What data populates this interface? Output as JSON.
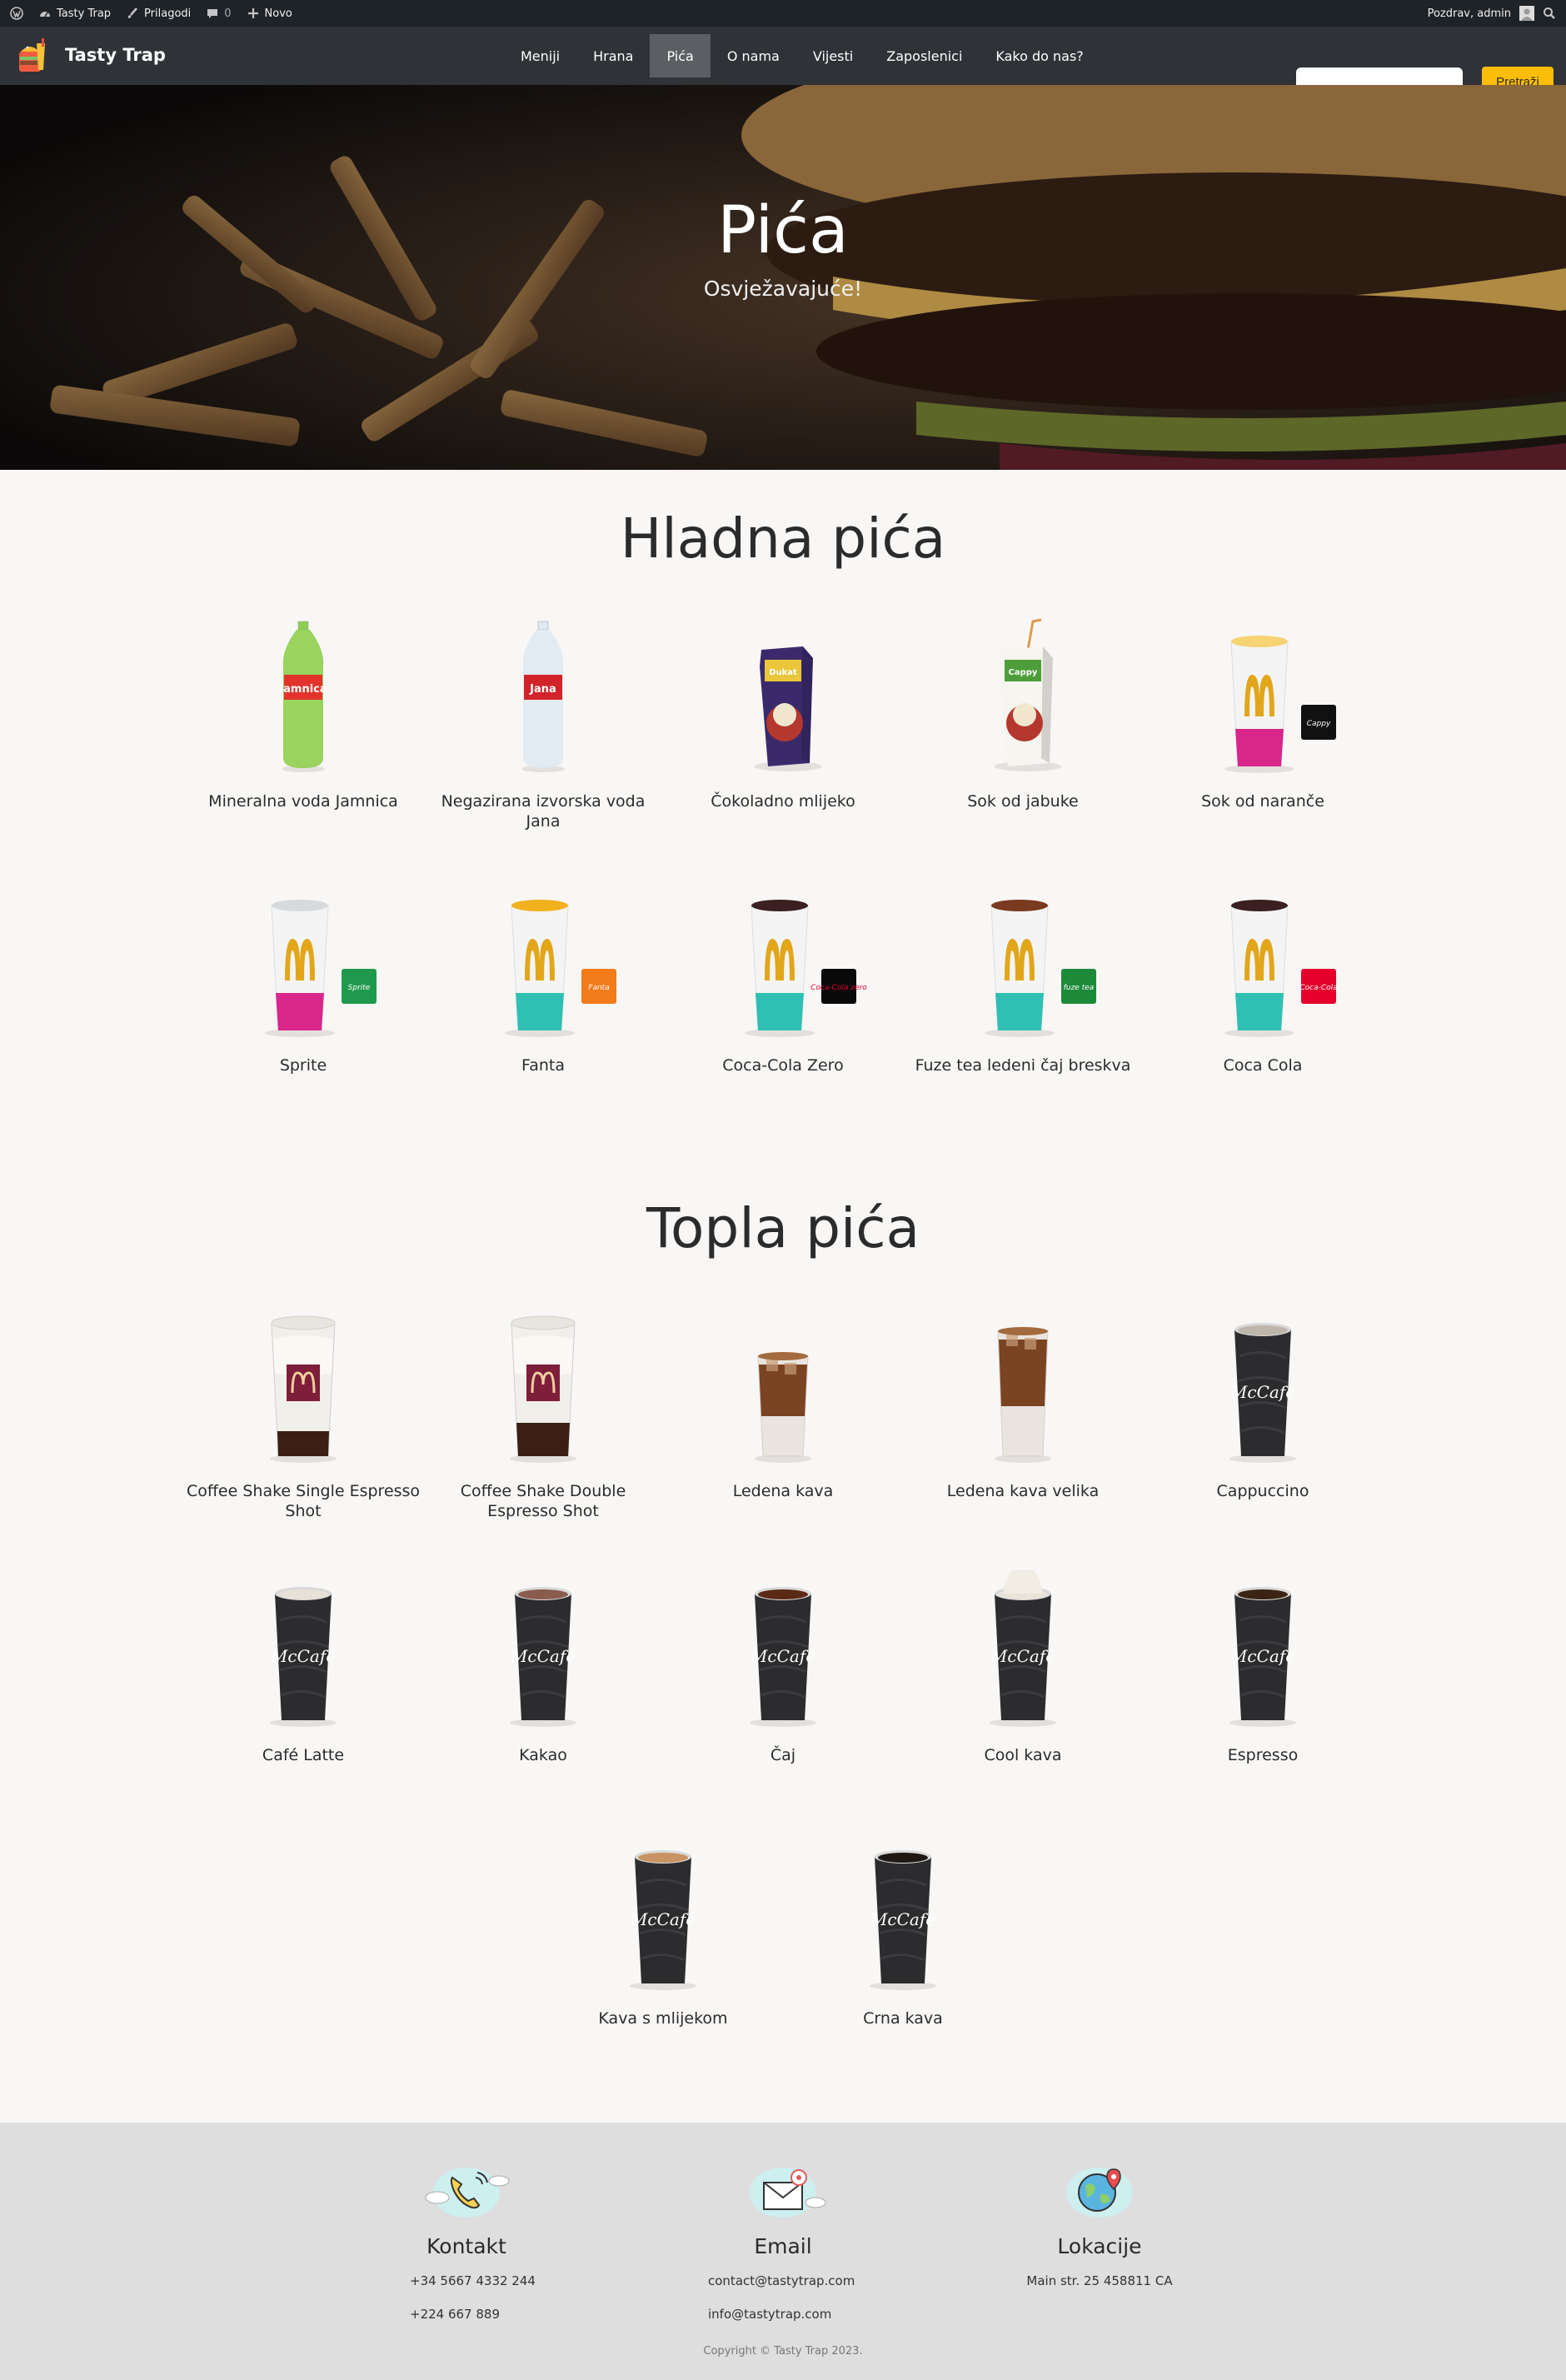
{
  "admin_bar": {
    "site_name": "Tasty Trap",
    "customize": "Prilagodi",
    "comments_count": "0",
    "new_label": "Novo",
    "greeting": "Pozdrav, admin"
  },
  "nav": {
    "brand": "Tasty Trap",
    "menu": [
      "Meniji",
      "Hrana",
      "Pića",
      "O nama",
      "Vijesti",
      "Zaposlenici",
      "Kako do nas?"
    ],
    "active_index": 2,
    "search_placeholder": "",
    "search_button": "Pretraži"
  },
  "hero": {
    "title": "Pića",
    "subtitle": "Osvježavajuće!"
  },
  "cold": {
    "title": "Hladna pića",
    "items": [
      "Mineralna voda Jamnica",
      "Negazirana izvorska voda Jana",
      "Čokoladno mlijeko",
      "Sok od jabuke",
      "Sok od naranče",
      "Sprite",
      "Fanta",
      "Coca-Cola Zero",
      "Fuze tea ledeni čaj breskva",
      "Coca Cola"
    ]
  },
  "hot": {
    "title": "Topla pića",
    "items": [
      "Coffee Shake Single Espresso Shot",
      "Coffee Shake Double Espresso Shot",
      "Ledena kava",
      "Ledena kava velika",
      "Cappuccino",
      "Café Latte",
      "Kakao",
      "Čaj",
      "Cool kava",
      "Espresso",
      "Kava s mlijekom",
      "Crna kava"
    ]
  },
  "product_logos": {
    "cappy": "Cappy",
    "sprite": "Sprite",
    "fanta": "Fanta",
    "coke_zero": "Coca-Cola zero",
    "fuze": "fuze tea",
    "coke": "Coca-Cola",
    "jana": "Jana",
    "dukat": "Dukat",
    "mccafe": "McCafé"
  },
  "footer": {
    "contact": {
      "title": "Kontakt",
      "lines": [
        "+34 5667 4332 244",
        "+224 667 889"
      ]
    },
    "email": {
      "title": "Email",
      "lines": [
        "contact@tastytrap.com",
        "info@tastytrap.com"
      ]
    },
    "locations": {
      "title": "Lokacije",
      "lines": [
        "Main str. 25 458811 CA"
      ]
    },
    "copyright": "Copyright © Tasty Trap 2023."
  },
  "colors": {
    "admin_bar": "#1d2327",
    "nav": "#2f3237",
    "nav_active": "#5b5e63",
    "accent": "#fbbd08",
    "page_bg": "#f8f7f5",
    "footer_bg": "#dededf",
    "mcd_yellow": "#e2a61a",
    "pink": "#d9268a",
    "teal": "#2fc0b3"
  }
}
